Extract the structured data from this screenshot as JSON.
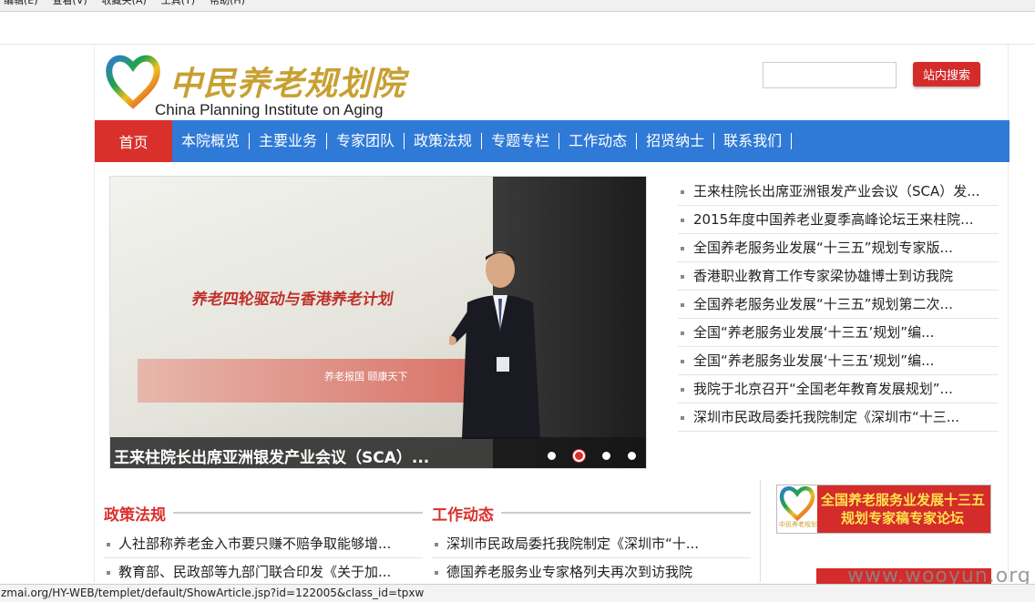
{
  "browser": {
    "menu": [
      "编辑(E)",
      "查看(V)",
      "收藏夹(A)",
      "工具(T)",
      "帮助(H)"
    ],
    "status_url": "zmai.org/HY-WEB/templet/default/ShowArticle.jsp?id=122005&class_id=tpxw"
  },
  "header": {
    "logo_cn": "中民养老规划院",
    "logo_en": "China Planning Institute on Aging",
    "search_placeholder": "",
    "search_button": "站内搜索"
  },
  "nav": {
    "home": "首页",
    "items": [
      "本院概览",
      "主要业务",
      "专家团队",
      "政策法规",
      "专题专栏",
      "工作动态",
      "招贤纳士",
      "联系我们"
    ]
  },
  "slider": {
    "caption": "王来柱院长出席亚洲银发产业会议（SCA）...",
    "screen_title": "养老四轮驱动与香港养老计划",
    "screen_band": "养老报国  颐康天下",
    "active_dot": 2,
    "dot_count": 4
  },
  "news": [
    "王来柱院长出席亚洲银发产业会议（SCA）发...",
    "2015年度中国养老业夏季高峰论坛王来柱院...",
    "全国养老服务业发展“十三五”规划专家版...",
    "香港职业教育工作专家梁协雄博士到访我院",
    "全国养老服务业发展“十三五”规划第二次...",
    "全国“养老服务业发展‘十三五’规划”编...",
    "全国“养老服务业发展‘十三五’规划”编...",
    "我院于北京召开“全国老年教育发展规划”...",
    "深圳市民政局委托我院制定《深圳市“十三..."
  ],
  "policy": {
    "title": "政策法规",
    "items": [
      "人社部称养老金入市要只赚不赔争取能够增...",
      "教育部、民政部等九部门联合印发《关于加..."
    ]
  },
  "work": {
    "title": "工作动态",
    "items": [
      "深圳市民政局委托我院制定《深圳市“十...",
      "德国养老服务业专家格列夫再次到访我院"
    ]
  },
  "banner": {
    "line1": "全国养老服务业发展十三五",
    "line2": "规划专家稿专家论坛",
    "logo_text": "中民养老规划"
  },
  "watermark": "www.wooyun.org",
  "colors": {
    "nav_blue": "#2f7ad6",
    "brand_red": "#d9302c",
    "logo_gold": "#c8a032"
  }
}
